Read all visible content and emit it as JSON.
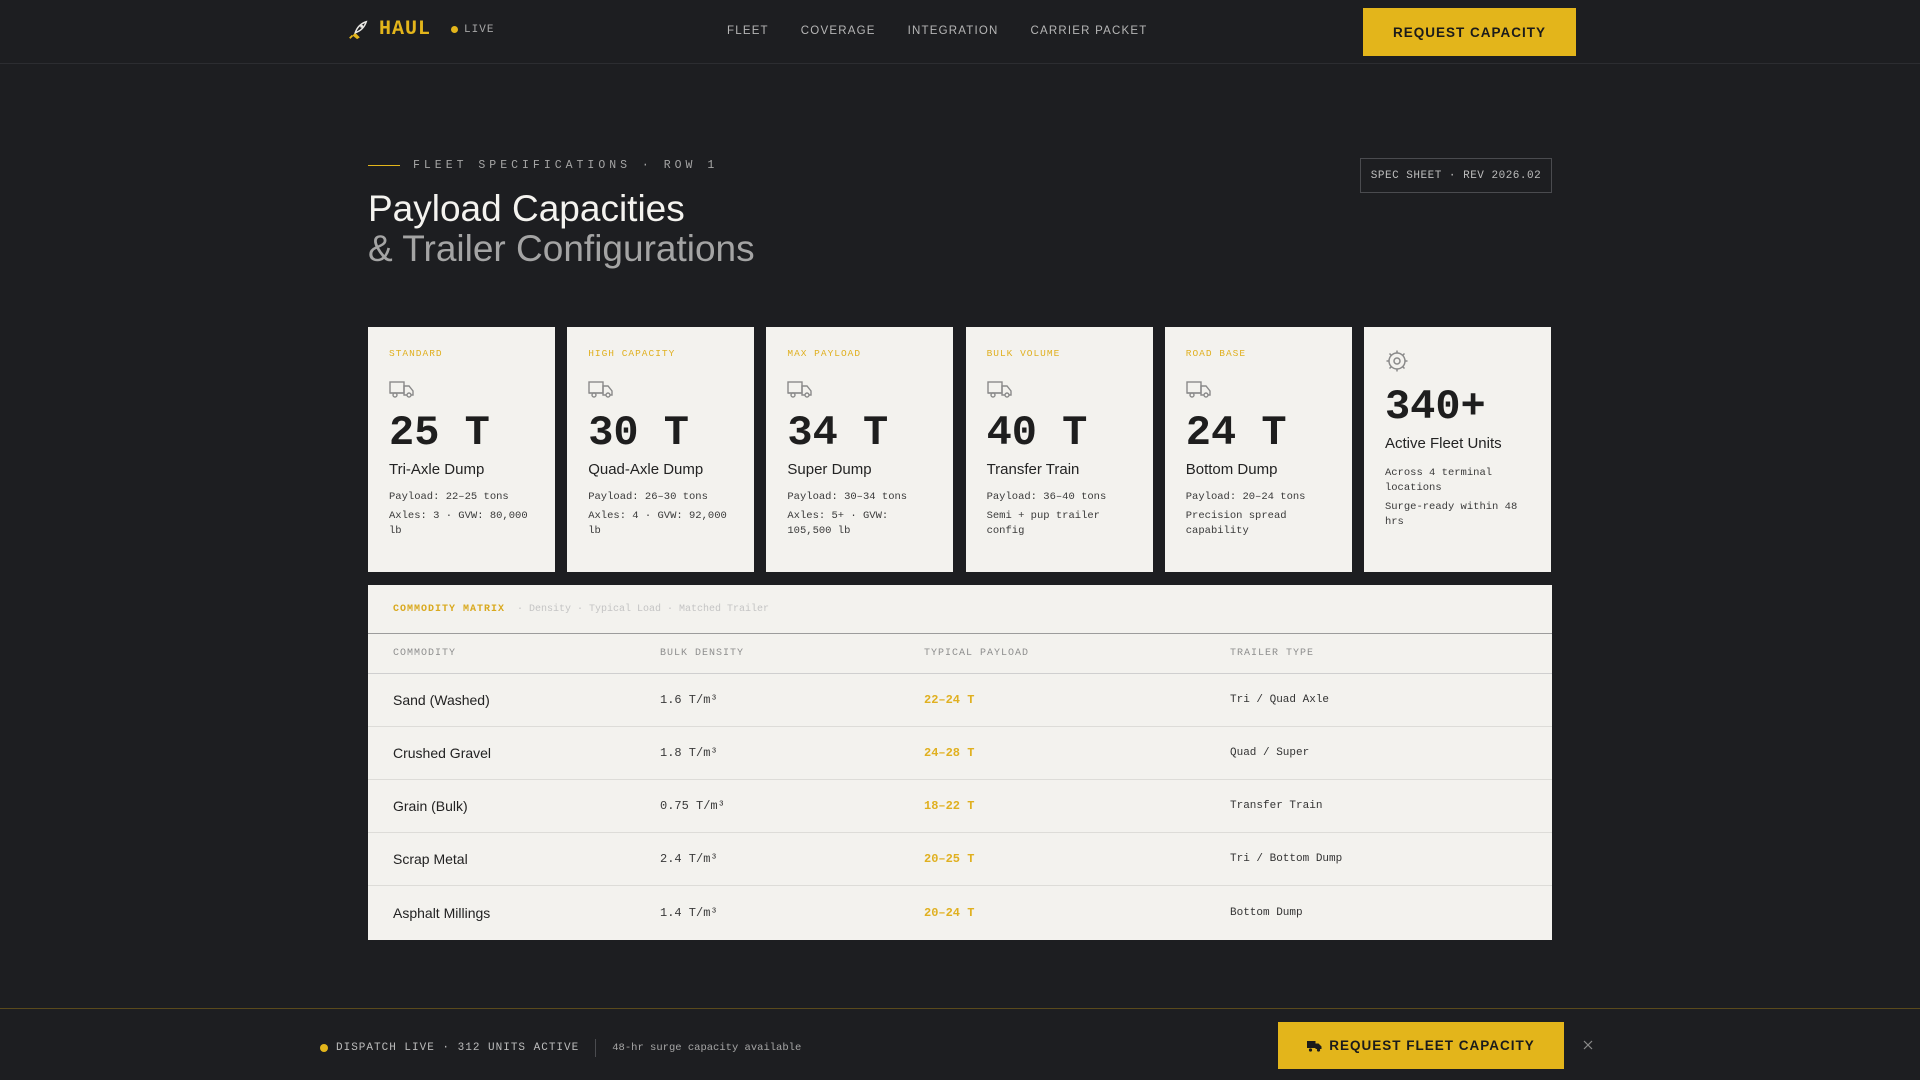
{
  "header": {
    "brand": "HAUL",
    "brand_icon": "rocket-icon",
    "live_label": "LIVE",
    "nav": [
      {
        "label": "FLEET"
      },
      {
        "label": "COVERAGE"
      },
      {
        "label": "INTEGRATION"
      },
      {
        "label": "CARRIER PACKET"
      }
    ],
    "cta": "REQUEST CAPACITY"
  },
  "section": {
    "eyebrow": "FLEET SPECIFICATIONS · ROW 1",
    "title_line1": "Payload Capacities",
    "title_line2": "& Trailer Configurations",
    "badge": "SPEC SHEET · REV 2026.02"
  },
  "cards": [
    {
      "tag": "STANDARD",
      "value": "25 T",
      "name": "Tri-Axle Dump",
      "line1": "Payload: 22–25 tons",
      "line2": "Axles: 3 · GVW: 80,000 lb"
    },
    {
      "tag": "HIGH CAPACITY",
      "value": "30 T",
      "name": "Quad-Axle Dump",
      "line1": "Payload: 26–30 tons",
      "line2": "Axles: 4 · GVW: 92,000 lb"
    },
    {
      "tag": "MAX PAYLOAD",
      "value": "34 T",
      "name": "Super Dump",
      "line1": "Payload: 30–34 tons",
      "line2": "Axles: 5+ · GVW: 105,500 lb"
    },
    {
      "tag": "BULK VOLUME",
      "value": "40 T",
      "name": "Transfer Train",
      "line1": "Payload: 36–40 tons",
      "line2": "Semi + pup trailer config"
    },
    {
      "tag": "ROAD BASE",
      "value": "24 T",
      "name": "Bottom Dump",
      "line1": "Payload: 20–24 tons",
      "line2": "Precision spread capability"
    }
  ],
  "fleet_card": {
    "value": "340+",
    "name": "Active Fleet Units",
    "line1": "Across 4 terminal locations",
    "line2": "Surge-ready within 48 hrs"
  },
  "matrix": {
    "title": "COMMODITY MATRIX",
    "subtitle": "· Density · Typical Load · Matched Trailer",
    "columns": [
      "COMMODITY",
      "BULK DENSITY",
      "TYPICAL PAYLOAD",
      "TRAILER TYPE"
    ],
    "rows": [
      {
        "commodity": "Sand (Washed)",
        "density": "1.6 T/m³",
        "payload": "22–24 T",
        "trailer": "Tri / Quad Axle"
      },
      {
        "commodity": "Crushed Gravel",
        "density": "1.8 T/m³",
        "payload": "24–28 T",
        "trailer": "Quad / Super"
      },
      {
        "commodity": "Grain (Bulk)",
        "density": "0.75 T/m³",
        "payload": "18–22 T",
        "trailer": "Transfer Train"
      },
      {
        "commodity": "Scrap Metal",
        "density": "2.4 T/m³",
        "payload": "20–25 T",
        "trailer": "Tri / Bottom Dump"
      },
      {
        "commodity": "Asphalt Millings",
        "density": "1.4 T/m³",
        "payload": "20–24 T",
        "trailer": "Bottom Dump"
      }
    ]
  },
  "footer": {
    "dispatch": "DISPATCH LIVE · 312 UNITS ACTIVE",
    "surge": "48-hr surge capacity available",
    "cta": "REQUEST FLEET CAPACITY",
    "cta_icon": "truck-icon",
    "close_icon": "close-icon"
  },
  "colors": {
    "background": "#1d1e21",
    "accent": "#e3b51b",
    "card": "#f3f2ee"
  }
}
